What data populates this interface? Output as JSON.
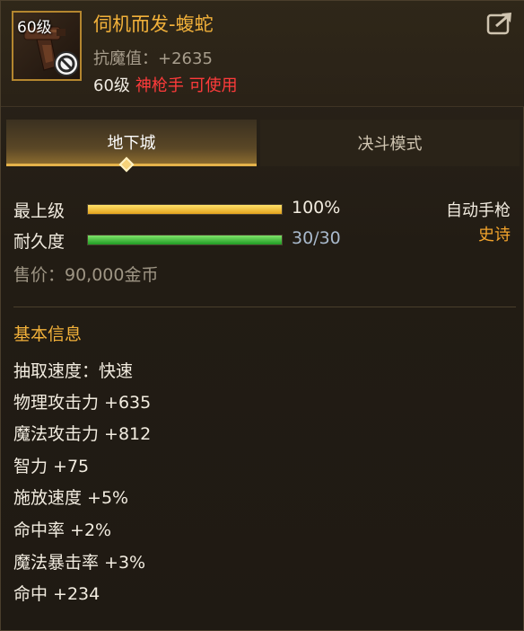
{
  "item": {
    "level_badge": "60级",
    "name": "伺机而发-蝮蛇",
    "resist": "抗魔值：+2635",
    "req_level": "60级",
    "req_class": "神枪手 可使用"
  },
  "tabs": [
    {
      "label": "地下城",
      "active": true
    },
    {
      "label": "决斗模式",
      "active": false
    }
  ],
  "stats": {
    "upgrade": {
      "label": "最上级",
      "value_text": "100%",
      "fill": 1.0
    },
    "durability": {
      "label": "耐久度",
      "value_text": "30/30",
      "fill": 1.0
    },
    "weapon_type": "自动手枪",
    "rarity": "史诗",
    "sale": "售价：90,000金币"
  },
  "basic": {
    "title": "基本信息",
    "lines": [
      "抽取速度：快速",
      "物理攻击力 +635",
      "魔法攻击力 +812",
      "智力 +75",
      "施放速度 +5%",
      "命中率 +2%",
      "魔法暴击率 +3%",
      "命中 +234"
    ]
  },
  "colors": {
    "name": "#f2b13a",
    "class_req": "#ff3b3b",
    "rarity": "#f2a32c",
    "bar_gold": "#e3a31d",
    "bar_green": "#1f9a23"
  },
  "icons": {
    "share": "share-icon",
    "unusable": "no-sign-icon",
    "weapon": "pistol-icon"
  }
}
